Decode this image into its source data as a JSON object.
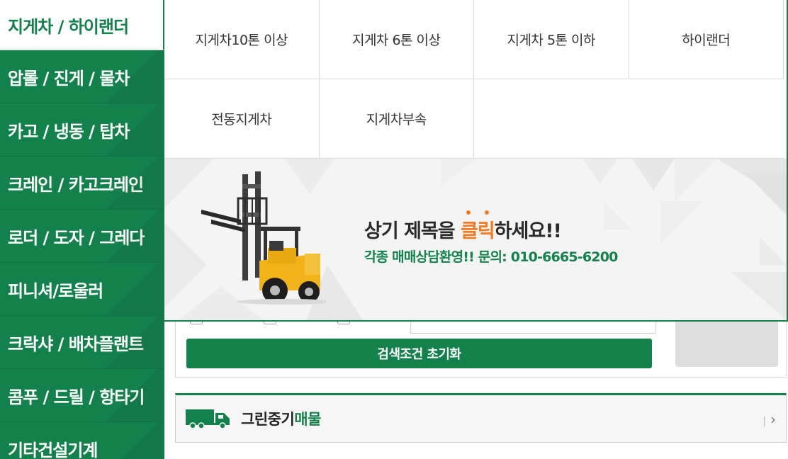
{
  "sidebar": {
    "items": [
      {
        "label": "지게차 / 하이랜더"
      },
      {
        "label": "압롤 / 진게 / 물차"
      },
      {
        "label": "카고 / 냉동 / 탑차"
      },
      {
        "label": "크레인 / 카고크레인"
      },
      {
        "label": "로더 / 도자 / 그레다"
      },
      {
        "label": "피니셔/로울러"
      },
      {
        "label": "크락샤 / 배차플랜트"
      },
      {
        "label": "콤푸 / 드릴 / 항타기"
      },
      {
        "label": "기타건설기계"
      }
    ]
  },
  "submenu": {
    "items": [
      {
        "label": "지게차10톤 이상"
      },
      {
        "label": "지게차 6톤 이상"
      },
      {
        "label": "지게차 5톤 이하"
      },
      {
        "label": "하이랜더"
      },
      {
        "label": "전동지게차"
      },
      {
        "label": "지게차부속"
      }
    ]
  },
  "banner": {
    "title_before": "상기 제목을 ",
    "title_highlight": "클릭",
    "title_after": "하세요!!",
    "subtitle": "각종 매매상담환영!! 문의: 010-6665-6200"
  },
  "search": {
    "reset_label": "검색조건 초기화"
  },
  "listing": {
    "title_main": "그린중기",
    "title_highlight": "매물",
    "arrow": "›"
  },
  "colors": {
    "brand_green": "#13814c",
    "accent_orange": "#f47b20"
  }
}
